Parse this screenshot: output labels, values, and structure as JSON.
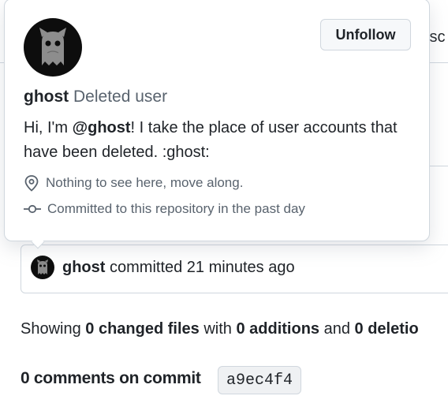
{
  "background": {
    "tab_fragment": "isc",
    "commit": {
      "user": "ghost",
      "text": "committed 21 minutes ago"
    },
    "showing": {
      "prefix": "Showing ",
      "changed_files": "0 changed files",
      "with": " with ",
      "additions": "0 additions",
      "and": " and ",
      "deletions": "0 deletio"
    },
    "comments_title": "0 comments on commit",
    "sha": "a9ec4f4"
  },
  "hovercard": {
    "login": "ghost",
    "full_name": "Deleted user",
    "unfollow_label": "Unfollow",
    "bio": {
      "before": "Hi, I'm ",
      "mention": "@ghost",
      "after": "! I take the place of user accounts that have been deleted. :ghost:"
    },
    "location": "Nothing to see here, move along.",
    "commit_note": "Committed to this repository in the past day",
    "icons": {
      "location": "location-pin-icon",
      "commit": "git-commit-icon"
    }
  }
}
